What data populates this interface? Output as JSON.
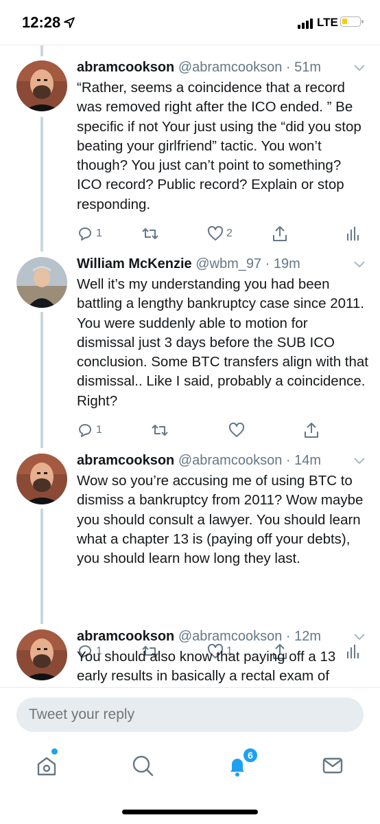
{
  "status_bar": {
    "time": "12:28",
    "network": "LTE"
  },
  "tweets": [
    {
      "display_name": "abramcookson",
      "handle": "@abramcookson",
      "time": "51m",
      "text": "“Rather, seems a coincidence that a record was removed right after the ICO ended. ” Be specific if not Your just using the “did you stop beating your girlfriend” tactic. You won’t though? You just can’t point to something? ICO record? Public record? Explain or stop responding.",
      "replies": "1",
      "retweets": "",
      "likes": "2"
    },
    {
      "display_name": "William McKenzie",
      "handle": "@wbm_97",
      "time": "19m",
      "text": "Well it’s my understanding you had been battling a lengthy bankruptcy case since 2011. You were suddenly able to motion for dismissal just 3 days before the SUB ICO conclusion. Some BTC transfers align with that dismissal.. Like I said, probably a coincidence. Right?",
      "replies": "1",
      "retweets": "",
      "likes": ""
    },
    {
      "display_name": "abramcookson",
      "handle": "@abramcookson",
      "time": "14m",
      "text": "Wow so you’re accusing me of using BTC to dismiss a bankruptcy from 2011? Wow maybe you should consult a lawyer. You should learn what a chapter 13 is (paying off your debts), you should learn how long they last.",
      "replies": "1",
      "retweets": "",
      "likes": "1"
    },
    {
      "display_name": "abramcookson",
      "handle": "@abramcookson",
      "time": "12m",
      "text": "You should also know that paying off a 13 early results in basically a rectal exam of",
      "replies": "",
      "retweets": "",
      "likes": ""
    }
  ],
  "reply": {
    "placeholder": "Tweet your reply"
  },
  "tab_bar": {
    "items": [
      "home-icon",
      "search-icon",
      "notifications-icon",
      "messages-icon"
    ],
    "notification_count": "6"
  },
  "colors": {
    "accent": "#1da1f2",
    "secondary_text": "#657786",
    "thread_line": "#ccd6dd"
  }
}
